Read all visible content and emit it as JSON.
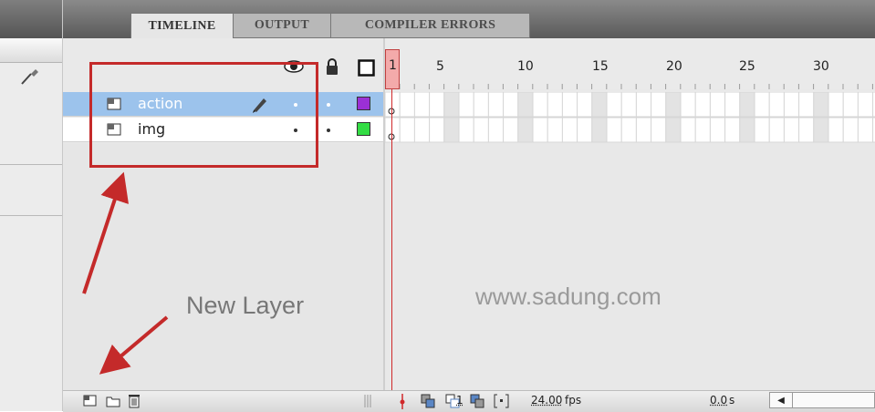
{
  "tabs": [
    {
      "label": "TIMELINE",
      "active": true
    },
    {
      "label": "OUTPUT",
      "active": false
    },
    {
      "label": "COMPILER ERRORS",
      "active": false
    }
  ],
  "ruler": {
    "current_frame": "1",
    "ticks": [
      "5",
      "10",
      "15",
      "20",
      "25",
      "30"
    ]
  },
  "header_icons": [
    "eye-icon",
    "lock-icon",
    "outline-icon"
  ],
  "layers": [
    {
      "name": "action",
      "selected": true,
      "color": "#9b30d6"
    },
    {
      "name": "img",
      "selected": false,
      "color": "#33dd44"
    }
  ],
  "annotations": {
    "new_layer_label": "New Layer",
    "watermark": "www.sadung.com",
    "highlight_color": "#c42a2a"
  },
  "status": {
    "frame": "1",
    "fps_value": "24.00",
    "fps_unit": "fps",
    "time_value": "0.0",
    "time_unit": "s"
  }
}
